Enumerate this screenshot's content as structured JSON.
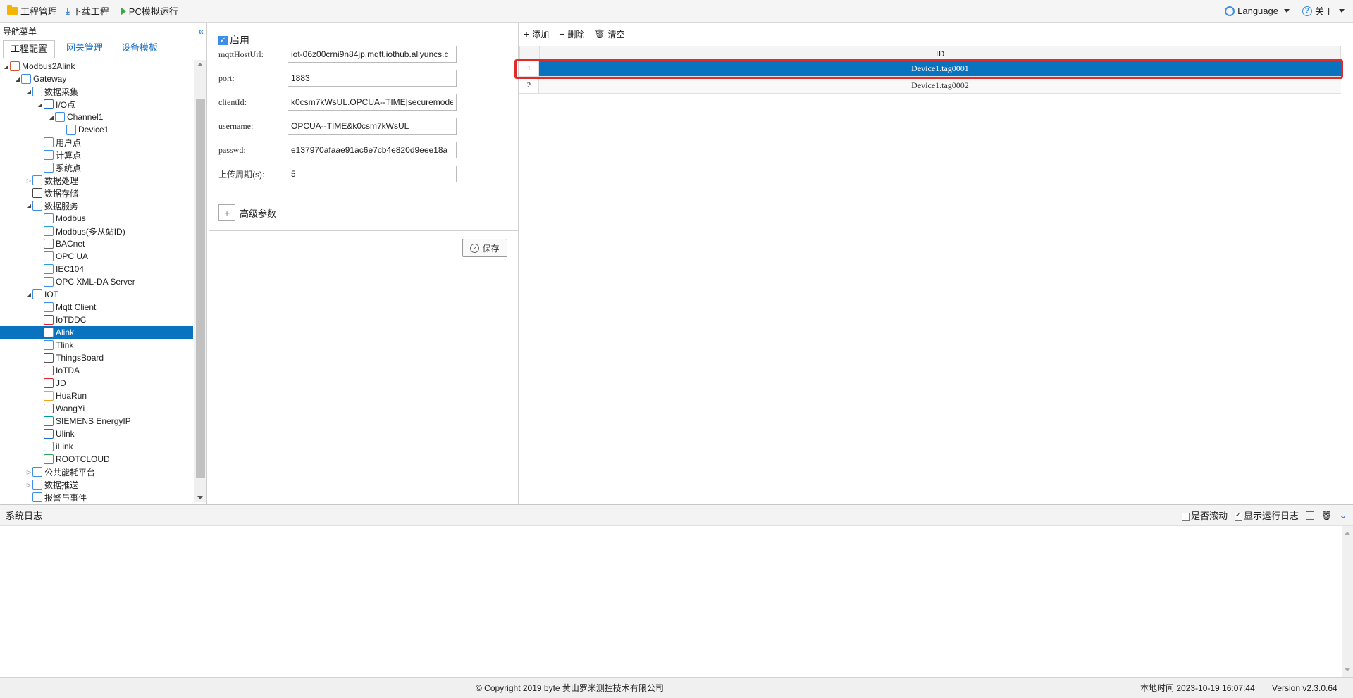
{
  "toolbar": {
    "project_mgmt": "工程管理",
    "download_project": "下载工程",
    "pc_simulate": "PC模拟运行",
    "language": "Language",
    "about": "关于"
  },
  "nav": {
    "title": "导航菜单",
    "tabs": [
      "工程配置",
      "网关管理",
      "设备模板"
    ],
    "tree": [
      {
        "label": "Modbus2Alink",
        "level": 0,
        "toggle": "open",
        "icon": "cube-stack-icon",
        "color": "#d9532c"
      },
      {
        "label": "Gateway",
        "level": 1,
        "toggle": "open",
        "icon": "gateway-icon",
        "color": "#3d8ee8"
      },
      {
        "label": "数据采集",
        "level": 2,
        "toggle": "open",
        "icon": "monitor-icon",
        "color": "#3d8ee8"
      },
      {
        "label": "I/O点",
        "level": 3,
        "toggle": "open",
        "icon": "io-icon",
        "color": "#1a6ec2"
      },
      {
        "label": "Channel1",
        "level": 4,
        "toggle": "open",
        "icon": "network-icon",
        "color": "#3d8ee8"
      },
      {
        "label": "Device1",
        "level": 5,
        "toggle": "none",
        "icon": "device-icon",
        "color": "#3d8ee8"
      },
      {
        "label": "用户点",
        "level": 3,
        "toggle": "none",
        "icon": "user-point-icon",
        "color": "#3d8ee8"
      },
      {
        "label": "计算点",
        "level": 3,
        "toggle": "none",
        "icon": "calc-point-icon",
        "color": "#3d8ee8"
      },
      {
        "label": "系统点",
        "level": 3,
        "toggle": "none",
        "icon": "system-point-icon",
        "color": "#3d8ee8"
      },
      {
        "label": "数据处理",
        "level": 2,
        "toggle": "closed",
        "icon": "chart-icon",
        "color": "#3d8ee8"
      },
      {
        "label": "数据存储",
        "level": 2,
        "toggle": "none",
        "icon": "database-icon",
        "color": "#444"
      },
      {
        "label": "数据服务",
        "level": 2,
        "toggle": "open",
        "icon": "service-icon",
        "color": "#3d8ee8"
      },
      {
        "label": "Modbus",
        "level": 3,
        "toggle": "none",
        "icon": "modbus-icon",
        "color": "#2a9fd6"
      },
      {
        "label": "Modbus(多从站ID)",
        "level": 3,
        "toggle": "none",
        "icon": "modbus-icon",
        "color": "#2a9fd6"
      },
      {
        "label": "BACnet",
        "level": 3,
        "toggle": "none",
        "icon": "bacnet-icon",
        "color": "#666"
      },
      {
        "label": "OPC UA",
        "level": 3,
        "toggle": "none",
        "icon": "opcua-icon",
        "color": "#3d8ee8"
      },
      {
        "label": "IEC104",
        "level": 3,
        "toggle": "none",
        "icon": "iec104-icon",
        "color": "#2a9fd6"
      },
      {
        "label": "OPC XML-DA Server",
        "level": 3,
        "toggle": "none",
        "icon": "opc-xml-icon",
        "color": "#3d8ee8"
      },
      {
        "label": "IOT",
        "level": 2,
        "toggle": "open",
        "icon": "iot-icon",
        "color": "#3d8ee8"
      },
      {
        "label": "Mqtt Client",
        "level": 3,
        "toggle": "none",
        "icon": "mqtt-icon",
        "color": "#3d8ee8"
      },
      {
        "label": "IoTDDC",
        "level": 3,
        "toggle": "none",
        "icon": "iotddc-icon",
        "color": "#d9232c"
      },
      {
        "label": "Alink",
        "level": 3,
        "toggle": "none",
        "icon": "alink-icon",
        "color": "#f27b1f",
        "selected": true
      },
      {
        "label": "Tlink",
        "level": 3,
        "toggle": "none",
        "icon": "tlink-icon",
        "color": "#3d8ee8"
      },
      {
        "label": "ThingsBoard",
        "level": 3,
        "toggle": "none",
        "icon": "thingsboard-icon",
        "color": "#555"
      },
      {
        "label": "IoTDA",
        "level": 3,
        "toggle": "none",
        "icon": "huawei-icon",
        "color": "#d9232c"
      },
      {
        "label": "JD",
        "level": 3,
        "toggle": "none",
        "icon": "jd-icon",
        "color": "#d9232c"
      },
      {
        "label": "HuaRun",
        "level": 3,
        "toggle": "none",
        "icon": "huarun-icon",
        "color": "#f2a31f"
      },
      {
        "label": "WangYi",
        "level": 3,
        "toggle": "none",
        "icon": "wangyi-icon",
        "color": "#d9232c"
      },
      {
        "label": "SIEMENS EnergyIP",
        "level": 3,
        "toggle": "none",
        "icon": "siemens-icon",
        "color": "#009999"
      },
      {
        "label": "Ulink",
        "level": 3,
        "toggle": "none",
        "icon": "ulink-icon",
        "color": "#1a6ec2"
      },
      {
        "label": "iLink",
        "level": 3,
        "toggle": "none",
        "icon": "ilink-icon",
        "color": "#3d8ee8"
      },
      {
        "label": "ROOTCLOUD",
        "level": 3,
        "toggle": "none",
        "icon": "rootcloud-icon",
        "color": "#2ea44f"
      },
      {
        "label": "公共能耗平台",
        "level": 2,
        "toggle": "closed",
        "icon": "energy-platform-icon",
        "color": "#3d8ee8"
      },
      {
        "label": "数据推送",
        "level": 2,
        "toggle": "closed",
        "icon": "push-icon",
        "color": "#3d8ee8"
      },
      {
        "label": "报警与事件",
        "level": 2,
        "toggle": "none",
        "icon": "alarm-icon",
        "color": "#3d8ee8"
      }
    ]
  },
  "form": {
    "enable_label": "启用",
    "mqtt_host_label": "mqttHostUrl:",
    "mqtt_host_value": "iot-06z00crni9n84jp.mqtt.iothub.aliyuncs.c",
    "port_label": "port:",
    "port_value": "1883",
    "client_id_label": "clientId:",
    "client_id_value": "k0csm7kWsUL.OPCUA--TIME|securemode",
    "username_label": "username:",
    "username_value": "OPCUA--TIME&k0csm7kWsUL",
    "passwd_label": "passwd:",
    "passwd_value": "e137970afaae91ac6e7cb4e820d9eee18a",
    "period_label": "上传周期(s):",
    "period_value": "5",
    "advanced_label": "高级参数",
    "save_label": "保存"
  },
  "table": {
    "add": "添加",
    "delete": "删除",
    "clear": "清空",
    "header": "ID",
    "rows": [
      {
        "num": "1",
        "id": "Device1.tag0001",
        "selected": true
      },
      {
        "num": "2",
        "id": "Device1.tag0002",
        "selected": false
      }
    ]
  },
  "log": {
    "title": "系统日志",
    "auto_scroll": "是否滚动",
    "show_run_log": "显示运行日志"
  },
  "footer": {
    "copyright": "© Copyright 2019 byte 黄山罗米测控技术有限公司",
    "local_time": "本地时间 2023-10-19 16:07:44",
    "version": "Version v2.3.0.64"
  },
  "colors": {
    "accent": "#0a73c0",
    "highlight": "#e12a2a"
  }
}
